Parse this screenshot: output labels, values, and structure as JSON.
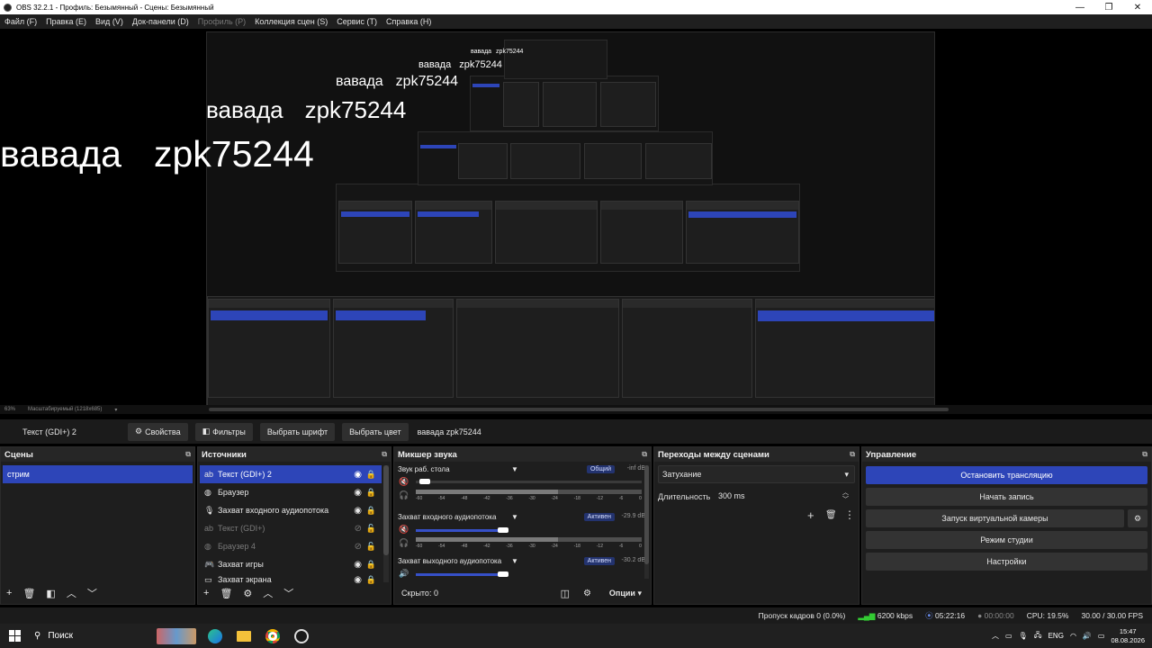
{
  "window": {
    "title": "OBS 32.2.1 - Профиль: Безымянный - Сцены: Безымянный"
  },
  "menu": [
    {
      "label": "Файл (F)",
      "disabled": false
    },
    {
      "label": "Правка (E)",
      "disabled": false
    },
    {
      "label": "Вид (V)",
      "disabled": false
    },
    {
      "label": "Док-панели (D)",
      "disabled": false
    },
    {
      "label": "Профиль (P)",
      "disabled": true
    },
    {
      "label": "Коллекция сцен (S)",
      "disabled": false
    },
    {
      "label": "Сервис (T)",
      "disabled": false
    },
    {
      "label": "Справка (H)",
      "disabled": false
    }
  ],
  "preview": {
    "text_word1": "вавада",
    "text_word2": "zpk75244",
    "zoom": "63%",
    "scale_mode": "Масштабируемый (1218x685)"
  },
  "source_toolbar": {
    "selected_source": "Текст (GDI+) 2",
    "properties": "Свойства",
    "filters": "Фильтры",
    "font": "Выбрать шрифт",
    "color": "Выбрать цвет",
    "text_value": "вавада  zpk75244"
  },
  "scenes": {
    "title": "Сцены",
    "items": [
      "стрим"
    ]
  },
  "sources": {
    "title": "Источники",
    "items": [
      {
        "label": "Текст (GDI+) 2",
        "icon": "text-icon",
        "visible": true,
        "selected": true
      },
      {
        "label": "Браузер",
        "icon": "globe-icon",
        "visible": true,
        "selected": false
      },
      {
        "label": "Захват входного аудиопотока",
        "icon": "mic-icon",
        "visible": true,
        "selected": false
      },
      {
        "label": "Текст (GDI+)",
        "icon": "text-icon",
        "visible": false,
        "selected": false
      },
      {
        "label": "Браузер 4",
        "icon": "globe-icon",
        "visible": false,
        "selected": false
      },
      {
        "label": "Захват игры",
        "icon": "gamepad-icon",
        "visible": true,
        "selected": false
      },
      {
        "label": "Захват экрана",
        "icon": "monitor-icon",
        "visible": true,
        "selected": false
      }
    ]
  },
  "mixer": {
    "title": "Микшер звука",
    "channels": [
      {
        "name": "Звук раб. стола",
        "badge": "Общий",
        "db": "-inf dB",
        "muted": true,
        "ticks": [
          "-60",
          "-54",
          "-48",
          "-42",
          "-36",
          "-30",
          "-24",
          "-18",
          "-12",
          "-6",
          "0"
        ]
      },
      {
        "name": "Захват входного аудиопотока",
        "badge": "Активен",
        "db": "-29.9 dB",
        "muted": true,
        "ticks": [
          "-60",
          "-54",
          "-48",
          "-42",
          "-36",
          "-30",
          "-24",
          "-18",
          "-12",
          "-6",
          "0"
        ]
      },
      {
        "name": "Захват выходного аудиопотока",
        "badge": "Активен",
        "db": "-30.2 dB",
        "muted": false
      }
    ],
    "hidden": "Скрыто: 0",
    "options": "Опции"
  },
  "transitions": {
    "title": "Переходы между сценами",
    "selected": "Затухание",
    "duration_label": "Длительность",
    "duration_value": "300 ms"
  },
  "controls": {
    "title": "Управление",
    "stop_stream": "Остановить трансляцию",
    "record": "Начать запись",
    "virtual_cam": "Запуск виртуальной камеры",
    "studio": "Режим студии",
    "settings": "Настройки"
  },
  "status": {
    "dropped": "Пропуск кадров 0 (0.0%)",
    "bitrate": "6200 kbps",
    "stream_time": "05:22:16",
    "rec_time": "00:00:00",
    "cpu": "CPU: 19.5%",
    "fps": "30.00 / 30.00 FPS"
  },
  "taskbar": {
    "search": "Поиск",
    "lang": "ENG",
    "time": "15:47",
    "date": "08.08.2026"
  },
  "colors": {
    "accent": "#2d45b8",
    "panel": "#1e1e1e",
    "bg": "#000000"
  }
}
